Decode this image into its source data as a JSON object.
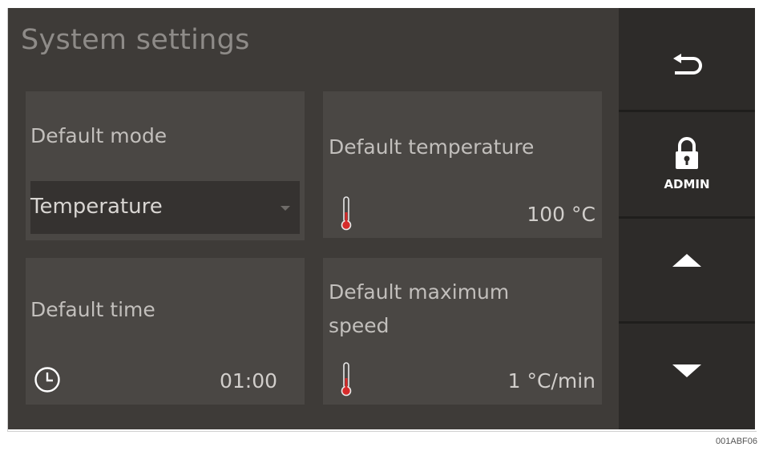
{
  "title": "System settings",
  "default_mode": {
    "label": "Default mode",
    "value": "Temperature"
  },
  "default_temperature": {
    "label": "Default temperature",
    "value": "100 °C",
    "icon": "thermometer-icon"
  },
  "default_time": {
    "label": "Default time",
    "value": "01:00",
    "icon": "clock-icon"
  },
  "default_max_speed": {
    "label_line1": "Default maximum",
    "label_line2": "speed",
    "value": "1 °C/min",
    "icon": "thermometer-icon"
  },
  "sidebar": {
    "back_icon": "back-arrow-icon",
    "admin_icon": "padlock-icon",
    "admin_label": "ADMIN",
    "up_icon": "arrow-up-icon",
    "down_icon": "arrow-down-icon"
  },
  "footnote": "001ABF06",
  "colors": {
    "screen_bg": "#3e3b38",
    "tile_bg": "#4a4744",
    "sidebar_bg": "#2d2b29",
    "thermo_red": "#d62b2b"
  }
}
